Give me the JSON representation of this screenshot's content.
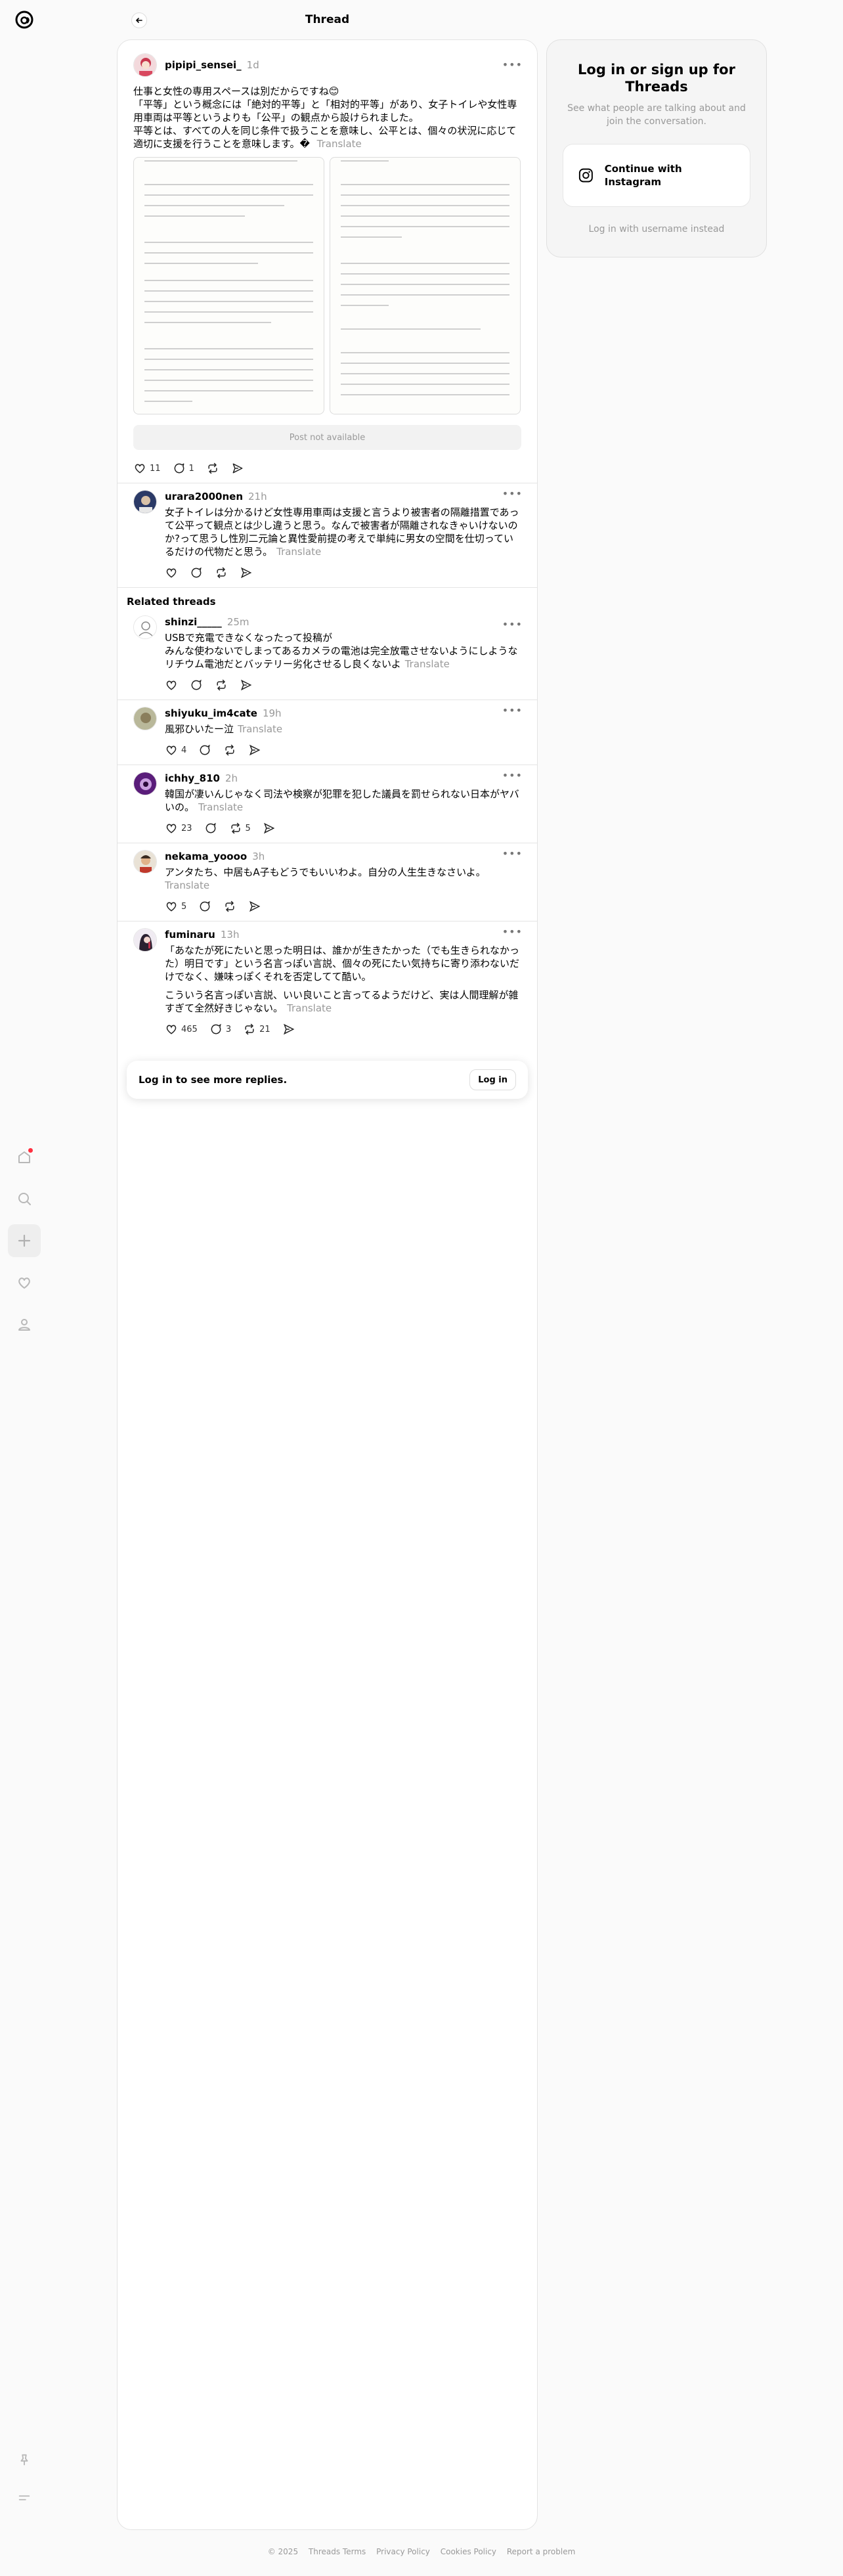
{
  "header": {
    "title": "Thread"
  },
  "nav": [
    {
      "icon": "home-icon",
      "has_notification": true
    },
    {
      "icon": "search-icon"
    },
    {
      "icon": "plus-icon"
    },
    {
      "icon": "heart-icon"
    },
    {
      "icon": "profile-icon"
    }
  ],
  "bottom_nav": [
    {
      "icon": "pin-icon"
    },
    {
      "icon": "menu-icon"
    }
  ],
  "main_post": {
    "username": "pipipi_sensei_",
    "time": "1d",
    "lines": [
      "仕事と女性の専用スペースは別だからですね😊",
      "「平等」という概念には「絶対的平等」と「相対的平等」があり、女子トイレや女性専",
      "用車両は平等というよりも「公平」の観点から設けられました。",
      "平等とは、すべての人を同じ条件で扱うことを意味し、公平とは、個々の状況に応じて",
      "適切に支援を行うことを意味します。"
    ],
    "translate": "Translate",
    "not_available": "Post not available",
    "likes": "11",
    "replies": "1"
  },
  "reply": {
    "username": "urara2000nen",
    "time": "21h",
    "lines": [
      "女子トイレは分かるけど女性専用車両は支援と言うより被害者の隔離措置であっ",
      "て公平って観点とは少し違うと思う。なんで被害者が隔離されなきゃいけないの",
      "か?って思うし性別二元論と異性愛前提の考えで単純に男女の空間を仕切ってい",
      "るだけの代物だと思う。"
    ],
    "translate": "Translate"
  },
  "related_title": "Related threads",
  "related": [
    {
      "username": "shinzi_____",
      "time": "25m",
      "lines": [
        "USBで充電できなくなったって投稿が",
        "みんな使わないでしまってあるカメラの電池は完全放電させないようにしような",
        "リチウム電池だとバッテリー劣化させるし良くないよ"
      ],
      "translate": "Translate",
      "likes": "",
      "replies": "",
      "reposts": ""
    },
    {
      "username": "shiyuku_im4cate",
      "time": "19h",
      "lines": [
        "風邪ひいたー泣"
      ],
      "translate": "Translate",
      "likes": "4",
      "replies": "",
      "reposts": ""
    },
    {
      "username": "ichhy_810",
      "time": "2h",
      "lines": [
        "韓国が凄いんじゃなく司法や検察が犯罪を犯した議員を罰せられない日本がヤバ",
        "いの。"
      ],
      "translate": "Translate",
      "likes": "23",
      "replies": "",
      "reposts": "5"
    },
    {
      "username": "nekama_yoooo",
      "time": "3h",
      "lines": [
        "アンタたち、中居もA子もどうでもいいわよ。自分の人生生きなさいよ。"
      ],
      "translate": "Translate",
      "likes": "5",
      "replies": "",
      "reposts": ""
    },
    {
      "username": "fuminaru",
      "time": "13h",
      "lines": [
        "「あなたが死にたいと思った明日は、誰かが生きたかった（でも生きられなかっ",
        "た）明日です」という名言っぽい言説、個々の死にたい気持ちに寄り添わないだ",
        "けでなく、嫌味っぽくそれを否定してて酷い。",
        "",
        "こういう名言っぽい言説、いい良いこと言ってるようだけど、実は人間理解が雑",
        "すぎて全然好きじゃない。"
      ],
      "translate": "Translate",
      "likes": "465",
      "replies": "3",
      "reposts": "21"
    }
  ],
  "login_prompt": {
    "text": "Log in to see more replies.",
    "button": "Log in"
  },
  "side": {
    "title": "Log in or sign up for Threads",
    "subtitle": "See what people are talking about and join the conversation.",
    "instagram": "Continue with Instagram",
    "alt": "Log in with username instead"
  },
  "footer": [
    "© 2025",
    "Threads Terms",
    "Privacy Policy",
    "Cookies Policy",
    "Report a problem"
  ]
}
